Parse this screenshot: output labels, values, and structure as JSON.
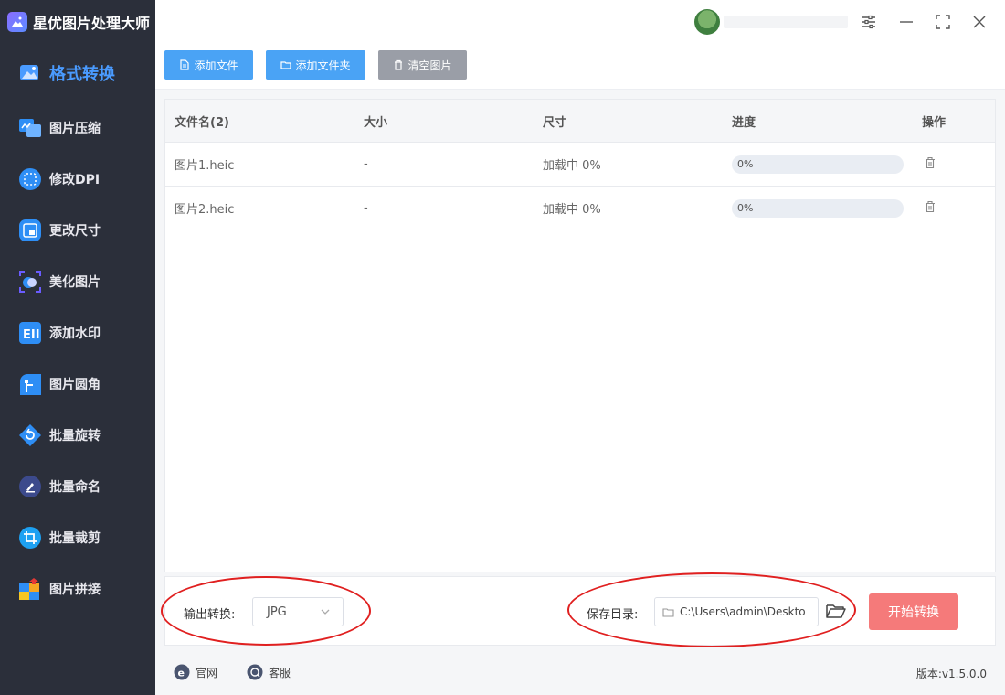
{
  "app": {
    "title": "星优图片处理大师"
  },
  "sidebar": {
    "items": [
      {
        "label": "格式转换",
        "icon": "image-icon",
        "color": "#4a9bff",
        "active": true
      },
      {
        "label": "图片压缩",
        "icon": "compress-icon",
        "color": "#2e8ef5"
      },
      {
        "label": "修改DPI",
        "icon": "dpi-icon",
        "color": "#2e8ef5"
      },
      {
        "label": "更改尺寸",
        "icon": "resize-icon",
        "color": "#2e8ef5"
      },
      {
        "label": "美化图片",
        "icon": "beautify-icon",
        "color": "#6a5cff"
      },
      {
        "label": "添加水印",
        "icon": "watermark-icon",
        "color": "#2e8ef5"
      },
      {
        "label": "图片圆角",
        "icon": "round-corner-icon",
        "color": "#2e8ef5"
      },
      {
        "label": "批量旋转",
        "icon": "rotate-icon",
        "color": "#2e8ef5"
      },
      {
        "label": "批量命名",
        "icon": "rename-icon",
        "color": "#4a5cc7"
      },
      {
        "label": "批量裁剪",
        "icon": "crop-icon",
        "color": "#1da1f2"
      },
      {
        "label": "图片拼接",
        "icon": "puzzle-icon",
        "color": "#f5a623"
      }
    ]
  },
  "toolbar": {
    "add_file": "添加文件",
    "add_folder": "添加文件夹",
    "clear": "清空图片"
  },
  "table": {
    "headers": [
      "文件名(2)",
      "大小",
      "尺寸",
      "进度",
      "操作"
    ],
    "rows": [
      {
        "name": "图片1.heic",
        "size": "-",
        "dimension": "加载中 0%",
        "progress": "0%",
        "progress_value": 0
      },
      {
        "name": "图片2.heic",
        "size": "-",
        "dimension": "加载中 0%",
        "progress": "0%",
        "progress_value": 0
      }
    ]
  },
  "options": {
    "output_label": "输出转换:",
    "output_format": "JPG",
    "save_label": "保存目录:",
    "save_path": "C:\\Users\\admin\\Deskto",
    "start": "开始转换"
  },
  "footer": {
    "website": "官网",
    "service": "客服",
    "version": "版本:v1.5.0.0"
  },
  "colors": {
    "accent": "#4aa3f5",
    "start_button": "#f57a7a",
    "annotation": "#e02020"
  }
}
